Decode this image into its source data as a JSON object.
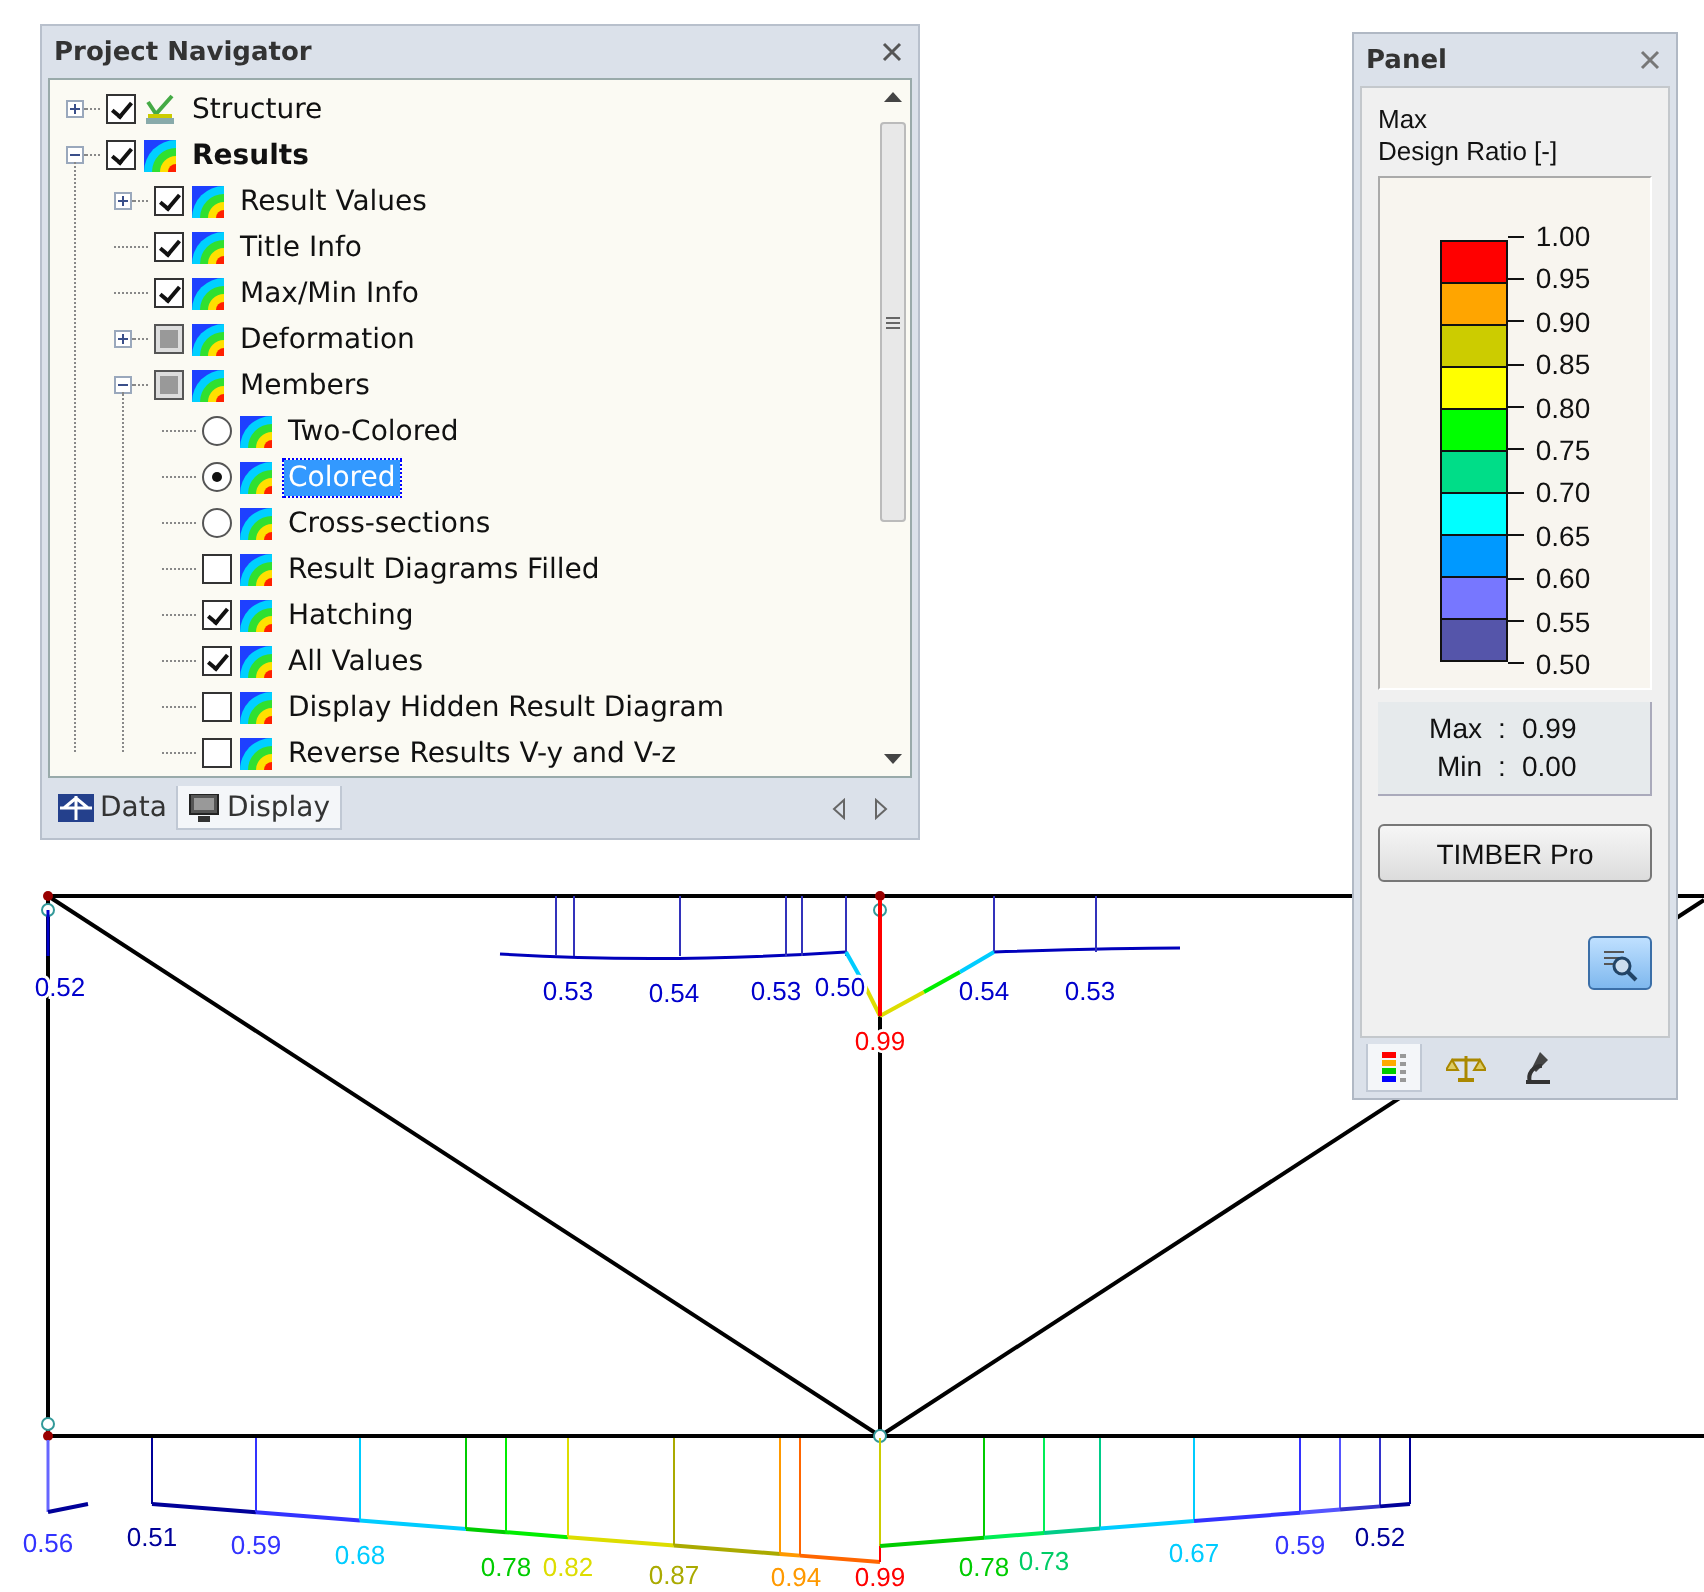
{
  "navigator": {
    "title": "Project Navigator",
    "tree": [
      {
        "label": "Structure",
        "kind": "checkbox",
        "checked": true,
        "expanded": false,
        "bold": false
      },
      {
        "label": "Results",
        "kind": "checkbox",
        "checked": true,
        "expanded": true,
        "bold": true,
        "children": [
          {
            "label": "Result Values",
            "kind": "checkbox",
            "checked": true,
            "expanded": false
          },
          {
            "label": "Title Info",
            "kind": "checkbox",
            "checked": true
          },
          {
            "label": "Max/Min Info",
            "kind": "checkbox",
            "checked": true
          },
          {
            "label": "Deformation",
            "kind": "checkbox",
            "checked": false,
            "indeterminate": true,
            "expanded": false
          },
          {
            "label": "Members",
            "kind": "checkbox",
            "checked": false,
            "indeterminate": true,
            "expanded": true,
            "children": [
              {
                "label": "Two-Colored",
                "kind": "radio",
                "selected": false
              },
              {
                "label": "Colored",
                "kind": "radio",
                "selected": true
              },
              {
                "label": "Cross-sections",
                "kind": "radio",
                "selected": false
              },
              {
                "label": "Result Diagrams Filled",
                "kind": "checkbox",
                "checked": false
              },
              {
                "label": "Hatching",
                "kind": "checkbox",
                "checked": true
              },
              {
                "label": "All Values",
                "kind": "checkbox",
                "checked": true
              },
              {
                "label": "Display Hidden Result Diagram",
                "kind": "checkbox",
                "checked": false
              },
              {
                "label": "Reverse Results V-y and V-z",
                "kind": "checkbox",
                "checked": false
              }
            ]
          }
        ]
      }
    ],
    "tabs": [
      {
        "label": "Data",
        "selected": false
      },
      {
        "label": "Display",
        "selected": true
      }
    ]
  },
  "panel": {
    "title": "Panel",
    "heading": [
      "Max",
      "Design Ratio [-]"
    ],
    "ticks": [
      "1.00",
      "0.95",
      "0.90",
      "0.85",
      "0.80",
      "0.75",
      "0.70",
      "0.65",
      "0.60",
      "0.55",
      "0.50"
    ],
    "bands": [
      {
        "color": "#ff0000"
      },
      {
        "color": "#ffa500"
      },
      {
        "color": "#cccc00"
      },
      {
        "color": "#ffff00"
      },
      {
        "color": "#00ff00"
      },
      {
        "color": "#00dd88"
      },
      {
        "color": "#00ffff"
      },
      {
        "color": "#0099ff"
      },
      {
        "color": "#7777ff"
      },
      {
        "color": "#5555aa"
      }
    ],
    "extremes": [
      {
        "label": "Max",
        "separator": ":",
        "value": "0.99"
      },
      {
        "label": "Min",
        "separator": ":",
        "value": "0.00"
      }
    ],
    "button": "TIMBER Pro",
    "tabs": [
      {
        "selected": true
      },
      {
        "selected": false
      },
      {
        "selected": false
      }
    ]
  },
  "diagram": {
    "top_values": [
      {
        "text": "0.52",
        "color": "#0000cc"
      },
      {
        "text": "0.53",
        "color": "#0000cc"
      },
      {
        "text": "0.54",
        "color": "#0000cc"
      },
      {
        "text": "0.53",
        "color": "#0000cc"
      },
      {
        "text": "0.50",
        "color": "#0000cc"
      },
      {
        "text": "0.99",
        "color": "#ff0000"
      },
      {
        "text": "0.54",
        "color": "#0000cc"
      },
      {
        "text": "0.53",
        "color": "#0000cc"
      }
    ],
    "bottom_values": [
      {
        "text": "0.56",
        "color": "#3333ff"
      },
      {
        "text": "0.51",
        "color": "#000099"
      },
      {
        "text": "0.59",
        "color": "#3333ff"
      },
      {
        "text": "0.68",
        "color": "#00ccff"
      },
      {
        "text": "0.78",
        "color": "#00cc00"
      },
      {
        "text": "0.82",
        "color": "#dddd00"
      },
      {
        "text": "0.87",
        "color": "#aaaa00"
      },
      {
        "text": "0.94",
        "color": "#ff9900"
      },
      {
        "text": "0.99",
        "color": "#ff0000"
      },
      {
        "text": "0.78",
        "color": "#00cc00"
      },
      {
        "text": "0.73",
        "color": "#00cc66"
      },
      {
        "text": "0.67",
        "color": "#00ccff"
      },
      {
        "text": "0.59",
        "color": "#3333ff"
      },
      {
        "text": "0.52",
        "color": "#000099"
      }
    ]
  }
}
